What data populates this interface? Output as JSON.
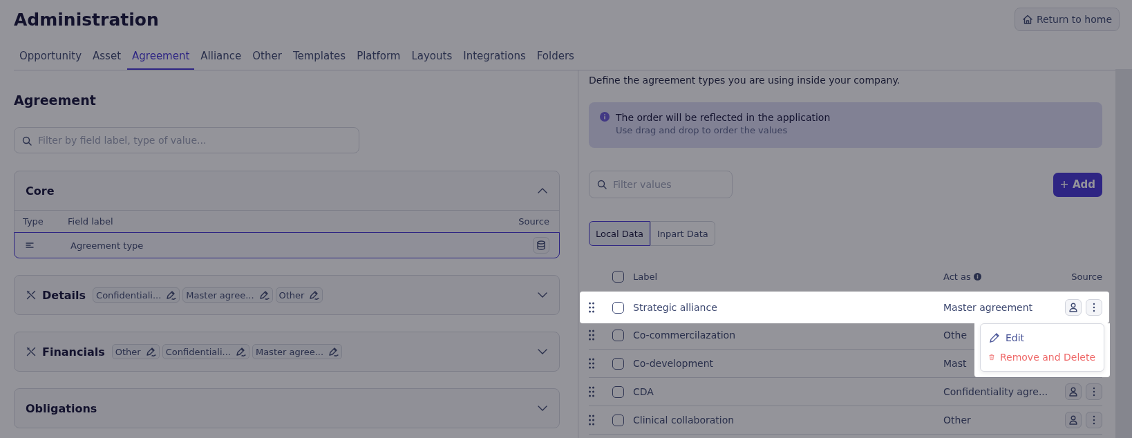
{
  "header": {
    "title": "Administration",
    "return_button": "Return to home"
  },
  "tabs": [
    {
      "label": "Opportunity",
      "selected": false
    },
    {
      "label": "Asset",
      "selected": false
    },
    {
      "label": "Agreement",
      "selected": true
    },
    {
      "label": "Alliance",
      "selected": false
    },
    {
      "label": "Other",
      "selected": false
    },
    {
      "label": "Templates",
      "selected": false
    },
    {
      "label": "Platform",
      "selected": false
    },
    {
      "label": "Layouts",
      "selected": false
    },
    {
      "label": "Integrations",
      "selected": false
    },
    {
      "label": "Folders",
      "selected": false
    }
  ],
  "left": {
    "heading": "Agreement",
    "search": {
      "placeholder": "Filter by field label, type of value..."
    },
    "sections": [
      {
        "title": "Core",
        "kind": "plain",
        "expanded": true,
        "columns": [
          "Type",
          "Field label",
          "Source"
        ],
        "rows": [
          {
            "label": "Agreement type",
            "selected": true
          }
        ]
      },
      {
        "title": "Details",
        "kind": "custom",
        "expanded": false,
        "chips": [
          "Confidentiali...",
          "Master agree...",
          "Other"
        ]
      },
      {
        "title": "Financials",
        "kind": "custom",
        "expanded": false,
        "chips": [
          "Other",
          "Confidentiali...",
          "Master agree..."
        ]
      },
      {
        "title": "Obligations",
        "kind": "plain",
        "expanded": false
      }
    ]
  },
  "right": {
    "description": "Define the agreement types you are using inside your company.",
    "notice": {
      "title": "The order will be reflected in the application",
      "text": "Use drag and drop to order the values"
    },
    "search": {
      "placeholder": "Filter values"
    },
    "add_button": "Add",
    "toggle": [
      {
        "label": "Local Data",
        "selected": true
      },
      {
        "label": "Inpart Data",
        "selected": false
      }
    ],
    "table": {
      "columns": [
        "Label",
        "Act as",
        "Source"
      ],
      "all_checked": false,
      "rows": [
        {
          "label": "Strategic alliance",
          "act_as": "Master agreement",
          "checked": false,
          "highlighted": true
        },
        {
          "label": "Co-commercilazation",
          "act_as": "Othe",
          "checked": false,
          "highlighted": false
        },
        {
          "label": "Co-development",
          "act_as": "Mast",
          "checked": false,
          "highlighted": false
        },
        {
          "label": "CDA",
          "act_as": "Confidentiality agre...",
          "checked": false,
          "highlighted": false
        },
        {
          "label": "Clinical collaboration",
          "act_as": "Other",
          "checked": false,
          "highlighted": false
        }
      ]
    },
    "menu": [
      {
        "label": "Edit",
        "kind": "edit"
      },
      {
        "label": "Remove and Delete",
        "kind": "delete"
      }
    ]
  }
}
